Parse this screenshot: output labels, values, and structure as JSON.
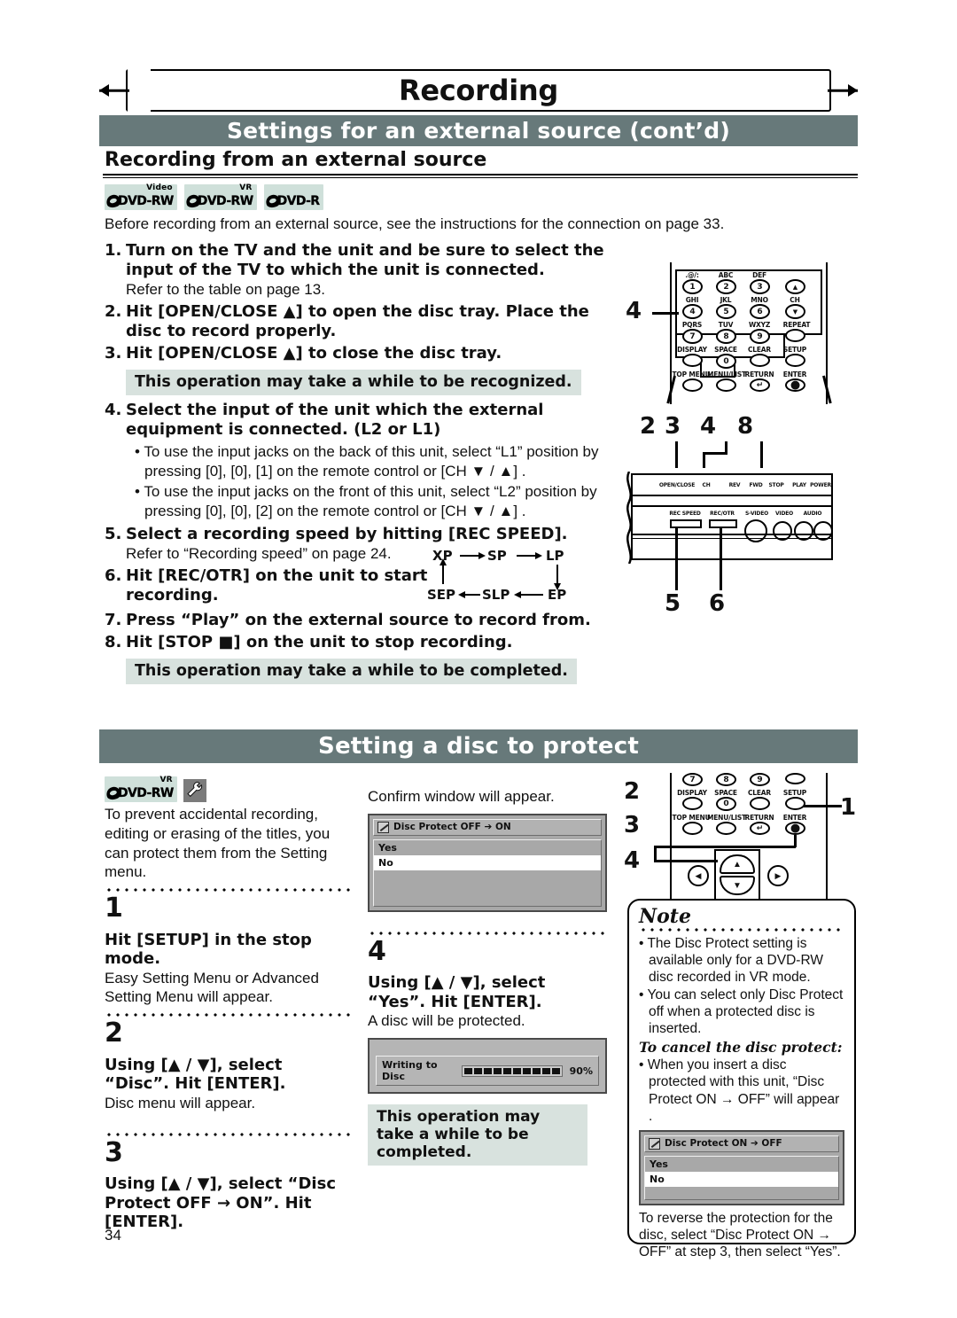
{
  "chapter": {
    "title": "Recording"
  },
  "section": {
    "bar_title": "Settings for an external source (cont’d)",
    "subtitle": "Recording from an external source"
  },
  "disc_logos": [
    {
      "name": "DVD-RW",
      "mode": "Video"
    },
    {
      "name": "DVD-RW",
      "mode": "VR"
    },
    {
      "name": "DVD-R",
      "mode": ""
    }
  ],
  "intro": "Before recording from an external source, see the instructions for the connection on page 33.",
  "steps": [
    {
      "num": "1.",
      "text": "Turn on the TV and the unit and be sure to select the input of the TV to which the unit is connected.",
      "sub": "Refer to the table on page 13."
    },
    {
      "num": "2.",
      "text": "Hit [OPEN/CLOSE ▲] to open the disc tray. Place the disc to record properly.",
      "sub": ""
    },
    {
      "num": "3.",
      "text": "Hit [OPEN/CLOSE ▲] to close the disc tray.",
      "sub": ""
    }
  ],
  "highlight_recognized": "This operation may take a while to be recognized.",
  "step4": {
    "num": "4.",
    "text": "Select the input of the unit which the external equipment is connected. (L2 or L1)",
    "bullets": [
      "• To use the input jacks on the back of this unit, select “L1” position by pressing [0], [0], [1] on the remote control or [CH ▼ / ▲] .",
      "• To use the input jacks on the front of this unit, select “L2” position by pressing [0], [0], [2] on the remote control or [CH ▼ / ▲] ."
    ]
  },
  "steps_rest": [
    {
      "num": "5.",
      "text": "Select a recording speed by hitting [REC SPEED].",
      "sub": "Refer to “Recording speed” on page 24."
    },
    {
      "num": "6.",
      "text": "Hit [REC/OTR] on the unit to start recording.",
      "sub": ""
    },
    {
      "num": "7.",
      "text": "Press “Play” on the external source to record from.",
      "sub": ""
    },
    {
      "num": "8.",
      "text": "Hit [STOP ■] on the unit to stop recording.",
      "sub": ""
    }
  ],
  "highlight_completed": "This operation may take a while to be completed.",
  "speed_cycle": {
    "top": [
      "XP",
      "SP",
      "LP"
    ],
    "bottom": [
      "SEP",
      "SLP",
      "EP"
    ]
  },
  "remote_top": {
    "callout": "4",
    "keys": [
      {
        "label": ".@/:",
        "digit": "1"
      },
      {
        "label": "ABC",
        "digit": "2"
      },
      {
        "label": "DEF",
        "digit": "3"
      },
      {
        "label": "",
        "digit": "▲"
      },
      {
        "label": "GHI",
        "digit": "4"
      },
      {
        "label": "JKL",
        "digit": "5"
      },
      {
        "label": "MNO",
        "digit": "6"
      },
      {
        "label": "CH",
        "digit": "▼"
      },
      {
        "label": "PQRS",
        "digit": "7"
      },
      {
        "label": "TUV",
        "digit": "8"
      },
      {
        "label": "WXYZ",
        "digit": "9"
      },
      {
        "label": "REPEAT",
        "digit": ""
      },
      {
        "label": "DISPLAY",
        "digit": ""
      },
      {
        "label": "SPACE",
        "digit": "0"
      },
      {
        "label": "CLEAR",
        "digit": ""
      },
      {
        "label": "SETUP",
        "digit": ""
      },
      {
        "label": "TOP MENU",
        "digit": ""
      },
      {
        "label": "MENU/LIST",
        "digit": ""
      },
      {
        "label": "RETURN",
        "digit": "↵"
      },
      {
        "label": "ENTER",
        "digit": "●"
      }
    ]
  },
  "front_panel": {
    "callouts_top": [
      "2",
      "3",
      "4",
      "8"
    ],
    "callouts_bottom": [
      "5",
      "6"
    ],
    "top_labels": [
      "OPEN/CLOSE",
      "CH",
      "REV",
      "FWD",
      "STOP",
      "PLAY",
      "POWER"
    ],
    "bottom_labels": [
      "REC SPEED",
      "REC/OTR",
      "S-VIDEO",
      "VIDEO",
      "AUDIO"
    ]
  },
  "disc_protect": {
    "bar_title": "Setting a disc to protect",
    "logo": {
      "name": "DVD-RW",
      "mode": "VR"
    },
    "intro": "To prevent accidental recording, editing or erasing of the titles, you can protect them from the Setting menu.",
    "steps": [
      {
        "num": "1",
        "bold": "Hit [SETUP] in the stop mode.",
        "sub": "Easy Setting Menu or Advanced Setting Menu will appear."
      },
      {
        "num": "2",
        "bold": "Using [▲ / ▼], select “Disc”. Hit [ENTER].",
        "sub": "Disc menu will appear."
      },
      {
        "num": "3",
        "bold": "Using [▲ / ▼], select “Disc Protect OFF → ON”. Hit [ENTER].",
        "sub": ""
      }
    ],
    "confirm_caption": "Confirm window will appear.",
    "confirm_dialog": {
      "title": "Disc Protect OFF ➔ ON",
      "items": [
        "Yes",
        "No"
      ],
      "selected": "No"
    },
    "step4": {
      "num": "4",
      "bold": "Using [▲ / ▼], select “Yes”. Hit [ENTER].",
      "sub": "A disc will be protected."
    },
    "progress_dialog": {
      "label": "Writing to Disc",
      "percent": "90%",
      "value": 90
    },
    "highlight_completed": "This operation may take a while to be completed."
  },
  "remote_bottom": {
    "callouts": [
      "2",
      "3",
      "4",
      "1"
    ],
    "digit_keys": [
      "7",
      "8",
      "9"
    ],
    "row1": [
      "DISPLAY",
      "SPACE",
      "CLEAR",
      "SETUP"
    ],
    "row1_digit": "0",
    "row2": [
      "TOP MENU",
      "MENU/LIST",
      "RETURN",
      "ENTER"
    ]
  },
  "note": {
    "title": "Note",
    "bullets": [
      "• The Disc Protect setting is available only for a DVD-RW disc recorded in VR mode.",
      "• You can select only Disc Protect off when a protected disc is inserted."
    ],
    "subtitle": "To cancel the disc protect:",
    "bullet2": "• When you insert a disc protected with this unit, “Disc Protect ON → OFF” will appear .",
    "dialog": {
      "title": "Disc Protect ON ➔ OFF",
      "items": [
        "Yes",
        "No"
      ],
      "selected": "No"
    },
    "tail": "To reverse the protection for the disc, select “Disc Protect ON → OFF” at step 3, then select “Yes”."
  },
  "page_number": "34"
}
